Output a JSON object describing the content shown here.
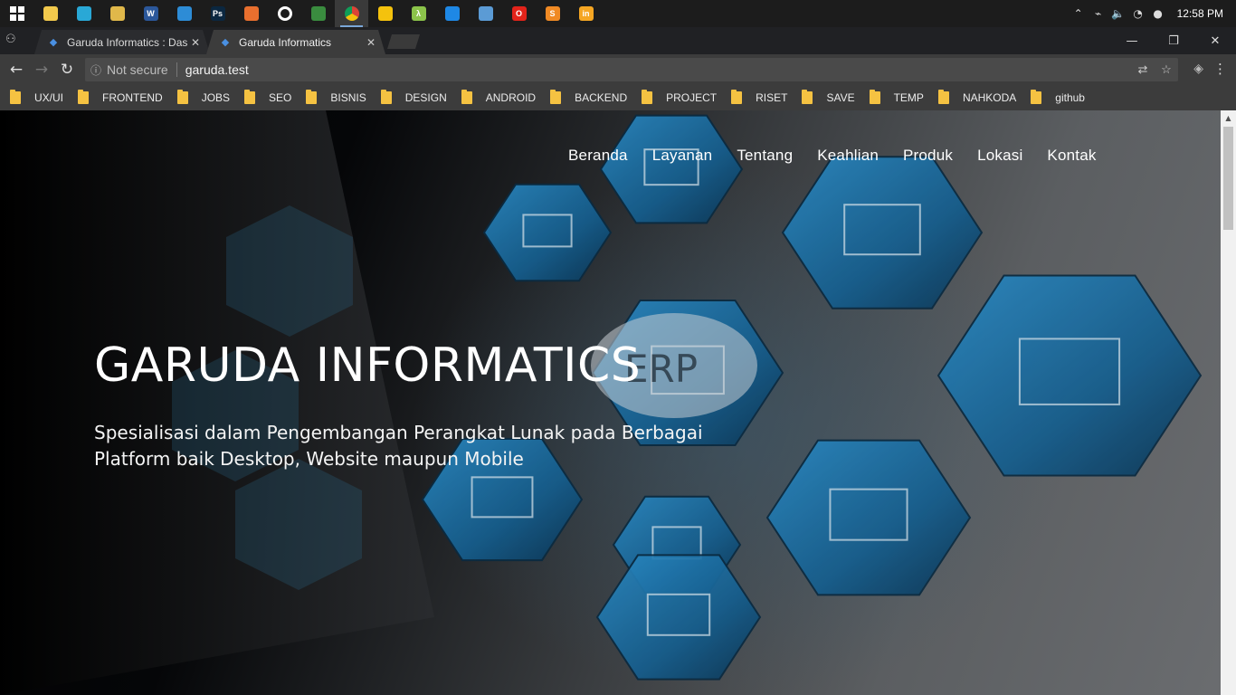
{
  "taskbar": {
    "icons": [
      {
        "name": "windows-start-icon",
        "color": "#ffffff"
      },
      {
        "name": "file-explorer-icon",
        "color": "#f2c94c"
      },
      {
        "name": "search-app-icon",
        "color": "#29a8d6"
      },
      {
        "name": "folder-app-icon",
        "color": "#e0b84a"
      },
      {
        "name": "word-icon",
        "color": "#2b579a",
        "glyph": "W"
      },
      {
        "name": "settings-app-icon",
        "color": "#2d8cd6"
      },
      {
        "name": "photoshop-icon",
        "color": "#0b2740",
        "glyph": "Ps"
      },
      {
        "name": "paint-icon",
        "color": "#e86f2e"
      },
      {
        "name": "circle-app-icon",
        "color": "#ffffff"
      },
      {
        "name": "spreadsheet-app-icon",
        "color": "#3a8c3f"
      },
      {
        "name": "chrome-icon",
        "color": "#db4437"
      },
      {
        "name": "keep-icon",
        "color": "#f4c20d"
      },
      {
        "name": "lambda-app-icon",
        "color": "#8bc34a",
        "glyph": "λ"
      },
      {
        "name": "hexagon-app-icon",
        "color": "#1e88e5"
      },
      {
        "name": "network-app-icon",
        "color": "#5b9bd5"
      },
      {
        "name": "opera-icon",
        "color": "#e2231a",
        "glyph": "O"
      },
      {
        "name": "sublime-icon",
        "color": "#f08a24",
        "glyph": "S"
      },
      {
        "name": "invision-icon",
        "color": "#f5a623",
        "glyph": "in"
      }
    ],
    "clock": "12:58 PM"
  },
  "browser": {
    "tabs": [
      {
        "title": "Garuda Informatics : Das"
      },
      {
        "title": "Garuda Informatics"
      }
    ],
    "security_label": "Not secure",
    "url": "garuda.test",
    "bookmarks": [
      "UX/UI",
      "FRONTEND",
      "JOBS",
      "SEO",
      "BISNIS",
      "DESIGN",
      "ANDROID",
      "BACKEND",
      "PROJECT",
      "RISET",
      "SAVE",
      "TEMP",
      "NAHKODA",
      "github"
    ]
  },
  "site": {
    "nav": [
      "Beranda",
      "Layanan",
      "Tentang",
      "Keahlian",
      "Produk",
      "Lokasi",
      "Kontak"
    ],
    "hero_title": "GARUDA INFORMATICS",
    "hero_subtitle": "Spesialisasi dalam Pengembangan Perangkat Lunak pada Berbagai Platform baik Desktop, Website maupun Mobile",
    "hex_label": "ERP",
    "accent_color": "#1f6fa3"
  }
}
